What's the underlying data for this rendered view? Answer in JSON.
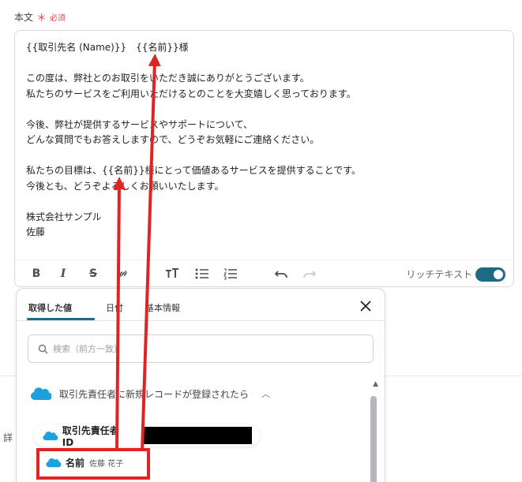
{
  "field": {
    "label": "本文",
    "required_mark": "＊",
    "required_text": "必須"
  },
  "editor": {
    "lines": [
      "{{取引先名 (Name)}}　{{名前}}様",
      "",
      "この度は、弊社とのお取引をいただき誠にありがとうございます。",
      "私たちのサービスをご利用いただけるとのことを大変嬉しく思っております。",
      "",
      "今後、弊社が提供するサービスやサポートについて、",
      "どんな質問でもお答えしますので、どうぞお気軽にご連絡ください。",
      "",
      "私たちの目標は、{{名前}}様にとって価値あるサービスを提供することです。",
      "今後とも、どうぞよろしくお願いいたします。",
      "",
      "株式会社サンプル",
      "佐藤"
    ],
    "toolbar": {
      "bold": "B",
      "italic": "I",
      "strike": "S",
      "rich_text_label": "リッチテキスト",
      "rich_text_enabled": true
    }
  },
  "background": {
    "side_text": "詳"
  },
  "picker": {
    "tabs": [
      {
        "label": "取得した値",
        "active": true
      },
      {
        "label": "日付",
        "active": false
      },
      {
        "label": "基本情報",
        "active": false
      }
    ],
    "search": {
      "placeholder": "検索（前方一致）",
      "value": ""
    },
    "section": {
      "title": "取引先責任者に新規レコードが登録されたら",
      "expanded": true
    },
    "items": [
      {
        "label": "取引先責任者ID",
        "value": ""
      },
      {
        "label": "名前",
        "value": "佐藤 花子"
      }
    ]
  },
  "colors": {
    "accent": "#1f6a84",
    "required": "#e5484d",
    "salesforce": "#1da1dc",
    "annotation": "#e02424"
  }
}
